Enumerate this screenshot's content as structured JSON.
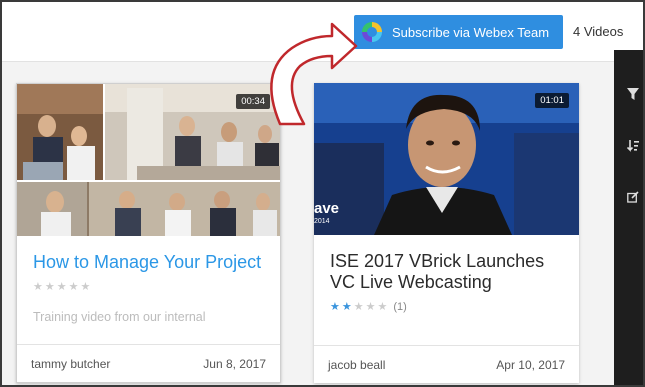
{
  "header": {
    "subscribe_label": "Subscribe via Webex Team",
    "video_count": "4 Videos"
  },
  "videos": [
    {
      "title": "How to Manage Your Project",
      "duration": "00:34",
      "rating": 0,
      "description": "Training video from our internal",
      "author": "tammy butcher",
      "date": "Jun 8, 2017"
    },
    {
      "title": "ISE 2017 VBrick Launches VC Live Webcasting",
      "duration": "01:01",
      "rating": 2,
      "rating_count": "(1)",
      "author": "jacob beall",
      "date": "Apr 10, 2017",
      "badge_text": "ave",
      "badge_year": "2014"
    }
  ],
  "colors": {
    "accent": "#2f8ee0",
    "title_link": "#2b97e6",
    "sidebar": "#1e1e1e"
  },
  "sidebar_icons": [
    "filter-icon",
    "sort-icon",
    "edit-icon"
  ]
}
